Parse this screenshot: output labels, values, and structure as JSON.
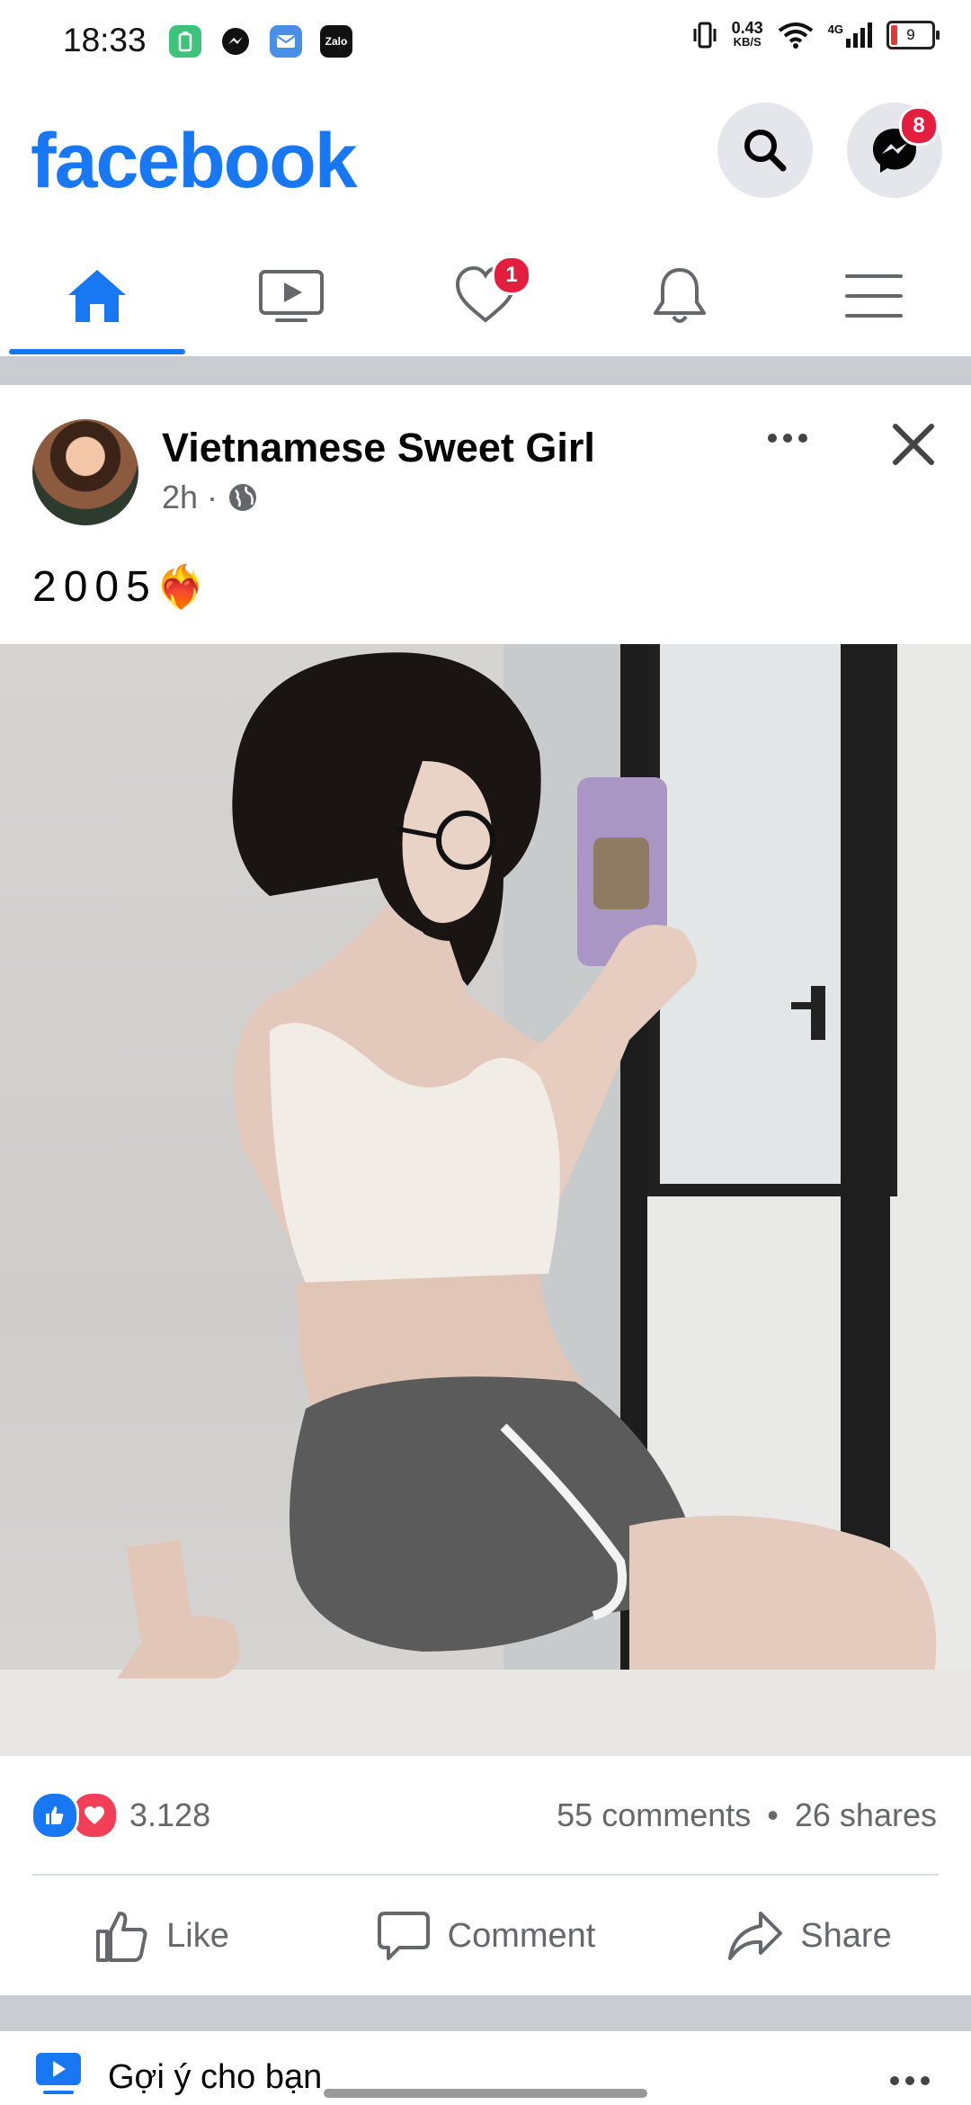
{
  "status_bar": {
    "time": "18:33",
    "app_icons": [
      "battery-saver-icon",
      "messenger-icon",
      "mail-icon",
      "zalo-icon"
    ],
    "zalo_label": "Zalo",
    "net_speed_value": "0.43",
    "net_speed_unit": "KB/S",
    "network_type": "4G",
    "battery_level": "9"
  },
  "header": {
    "logo": "facebook",
    "messenger_badge": "8",
    "brand_color": "#1877f2"
  },
  "tabs": [
    {
      "name": "home",
      "icon": "home-icon",
      "active": true
    },
    {
      "name": "watch",
      "icon": "video-icon",
      "active": false
    },
    {
      "name": "dating",
      "icon": "heart-icon",
      "badge": "1",
      "active": false
    },
    {
      "name": "notifications",
      "icon": "bell-icon",
      "active": false
    },
    {
      "name": "menu",
      "icon": "menu-icon",
      "active": false
    }
  ],
  "post": {
    "author": "Vietnamese Sweet Girl",
    "time": "2h",
    "separator": "·",
    "privacy_icon": "globe-icon",
    "caption": "2005",
    "caption_emoji": "❤️‍🔥",
    "reaction_count": "3.128",
    "comments": "55 comments",
    "shares": "26 shares",
    "stats_separator": "•"
  },
  "actions": {
    "like": "Like",
    "comment": "Comment",
    "share": "Share"
  },
  "suggestions": {
    "label": "Gợi ý cho bạn"
  }
}
